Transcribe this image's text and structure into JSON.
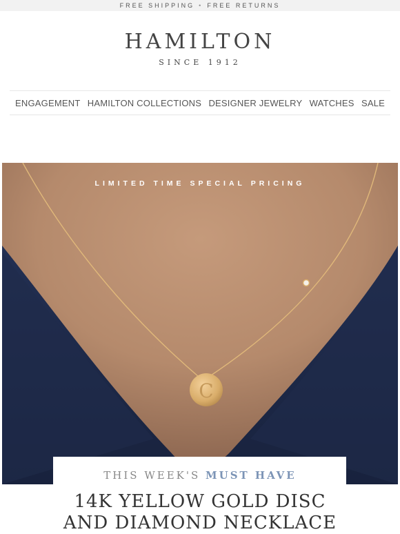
{
  "topbar": {
    "left": "FREE SHIPPING",
    "separator": "•",
    "right": "FREE RETURNS"
  },
  "brand": {
    "name": "HAMILTON",
    "since": "SINCE 1912"
  },
  "nav": {
    "items": [
      "ENGAGEMENT",
      "HAMILTON COLLECTIONS",
      "DESIGNER JEWELRY",
      "WATCHES",
      "SALE"
    ]
  },
  "hero": {
    "overlay_text": "LIMITED TIME SPECIAL PRICING",
    "pendant_letter": "C"
  },
  "promo": {
    "kicker_prefix": "THIS WEEK'S",
    "kicker_highlight": "MUST HAVE",
    "title_line1": "14K YELLOW GOLD DISC",
    "title_line2": "AND DIAMOND NECKLACE"
  },
  "colors": {
    "accent": "#7c94b6",
    "navy": "#1d2a4a",
    "gold": "#d9ad6a"
  }
}
